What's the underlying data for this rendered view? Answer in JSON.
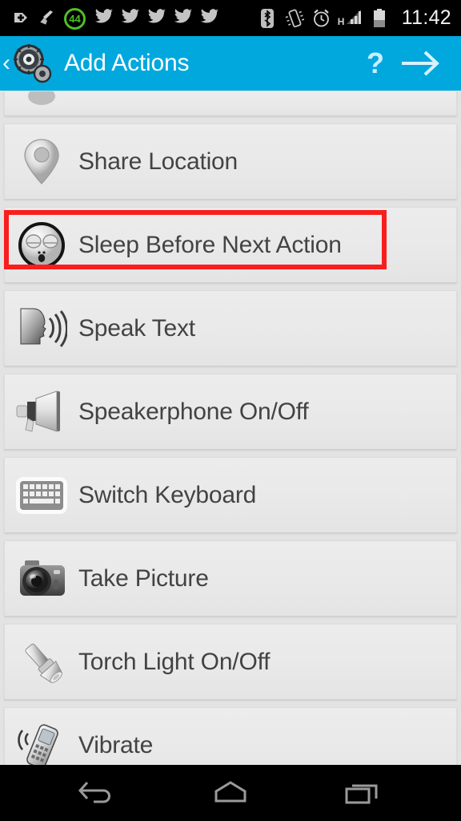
{
  "status_bar": {
    "time": "11:42",
    "cleaner_badge": "44",
    "signal_label": "H",
    "left_icons": [
      {
        "name": "app-update-icon",
        "label": "plus-badge"
      },
      {
        "name": "broom-cleaner-icon",
        "label": "broom"
      },
      {
        "name": "cleaner-score-badge",
        "label": "44"
      },
      {
        "name": "twitter-notification-icon-1",
        "label": "twitter"
      },
      {
        "name": "twitter-notification-icon-2",
        "label": "twitter"
      },
      {
        "name": "twitter-notification-icon-3",
        "label": "twitter"
      },
      {
        "name": "twitter-notification-icon-4",
        "label": "twitter"
      },
      {
        "name": "twitter-notification-icon-5",
        "label": "twitter"
      }
    ],
    "right_icons": [
      {
        "name": "bluetooth-icon",
        "label": "bluetooth"
      },
      {
        "name": "vibrate-mode-icon",
        "label": "vibrate"
      },
      {
        "name": "alarm-clock-icon",
        "label": "alarm"
      },
      {
        "name": "signal-bars-icon",
        "label": "H signal"
      },
      {
        "name": "battery-icon",
        "label": "battery"
      }
    ]
  },
  "action_bar": {
    "title": "Add Actions",
    "back_label": "‹",
    "help_label": "?",
    "app_icon_name": "gears-app-icon",
    "next_icon_name": "arrow-right-icon",
    "background_color": "#00a8dd",
    "title_color": "#ffffff"
  },
  "list": {
    "partial_top_row": {
      "label": "",
      "icon": "share-icon-partial"
    },
    "items": [
      {
        "label": "Share Location",
        "icon": "map-pin-icon"
      },
      {
        "label": "Sleep Before Next Action",
        "icon": "sleeping-face-icon",
        "highlighted": true
      },
      {
        "label": "Speak Text",
        "icon": "speaking-head-icon"
      },
      {
        "label": "Speakerphone On/Off",
        "icon": "megaphone-icon"
      },
      {
        "label": "Switch Keyboard",
        "icon": "keyboard-icon"
      },
      {
        "label": "Take Picture",
        "icon": "camera-icon"
      },
      {
        "label": "Torch Light On/Off",
        "icon": "flashlight-icon"
      },
      {
        "label": "Vibrate",
        "icon": "vibrating-phone-icon"
      }
    ],
    "highlight_color": "#fa1d1d",
    "row_background": "#e9e9e9",
    "text_color": "#434343"
  },
  "nav_bar": {
    "buttons": [
      {
        "name": "nav-back-button",
        "label": "back"
      },
      {
        "name": "nav-home-button",
        "label": "home"
      },
      {
        "name": "nav-recents-button",
        "label": "recents"
      }
    ]
  }
}
